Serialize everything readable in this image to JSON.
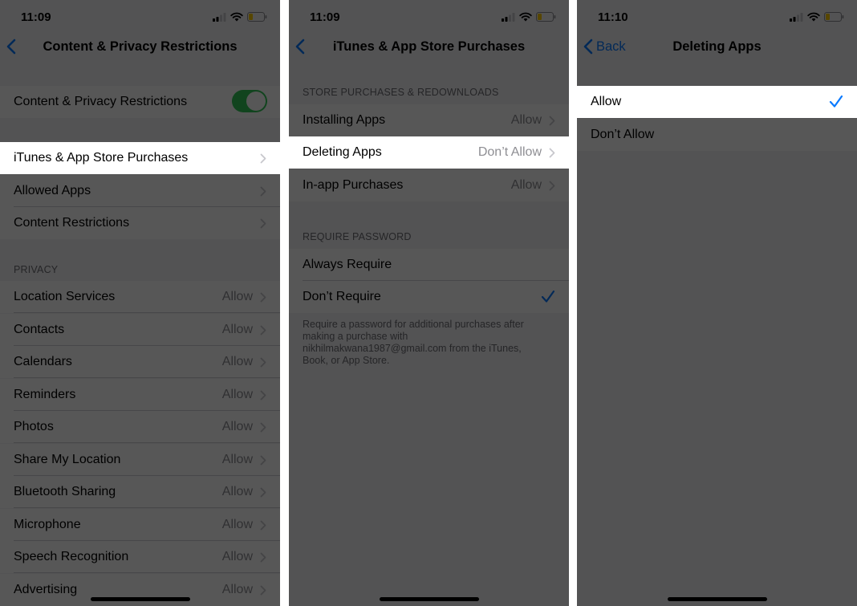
{
  "colors": {
    "accent": "#0a7aff",
    "toggle_on": "#34c759",
    "background": "#f2f2f7"
  },
  "panel1": {
    "time": "11:09",
    "title": "Content & Privacy Restrictions",
    "toggle_row": {
      "label": "Content & Privacy Restrictions",
      "state": "on"
    },
    "rows": [
      "iTunes & App Store Purchases",
      "Allowed Apps",
      "Content Restrictions"
    ],
    "privacy_header": "PRIVACY",
    "privacy_rows": [
      {
        "label": "Location Services",
        "value": "Allow"
      },
      {
        "label": "Contacts",
        "value": "Allow"
      },
      {
        "label": "Calendars",
        "value": "Allow"
      },
      {
        "label": "Reminders",
        "value": "Allow"
      },
      {
        "label": "Photos",
        "value": "Allow"
      },
      {
        "label": "Share My Location",
        "value": "Allow"
      },
      {
        "label": "Bluetooth Sharing",
        "value": "Allow"
      },
      {
        "label": "Microphone",
        "value": "Allow"
      },
      {
        "label": "Speech Recognition",
        "value": "Allow"
      },
      {
        "label": "Advertising",
        "value": "Allow"
      }
    ]
  },
  "panel2": {
    "time": "11:09",
    "title": "iTunes & App Store Purchases",
    "store_header": "STORE PURCHASES & REDOWNLOADS",
    "store_rows": [
      {
        "label": "Installing Apps",
        "value": "Allow"
      },
      {
        "label": "Deleting Apps",
        "value": "Don’t Allow"
      },
      {
        "label": "In-app Purchases",
        "value": "Allow"
      }
    ],
    "password_header": "REQUIRE PASSWORD",
    "password_rows": [
      {
        "label": "Always Require",
        "selected": false
      },
      {
        "label": "Don’t Require",
        "selected": true
      }
    ],
    "footer": "Require a password for additional purchases after making a purchase with nikhilmakwana1987@gmail.com from the iTunes, Book, or App Store."
  },
  "panel3": {
    "time": "11:10",
    "back_label": "Back",
    "title": "Deleting Apps",
    "options": [
      {
        "label": "Allow",
        "selected": true
      },
      {
        "label": "Don’t Allow",
        "selected": false
      }
    ]
  }
}
